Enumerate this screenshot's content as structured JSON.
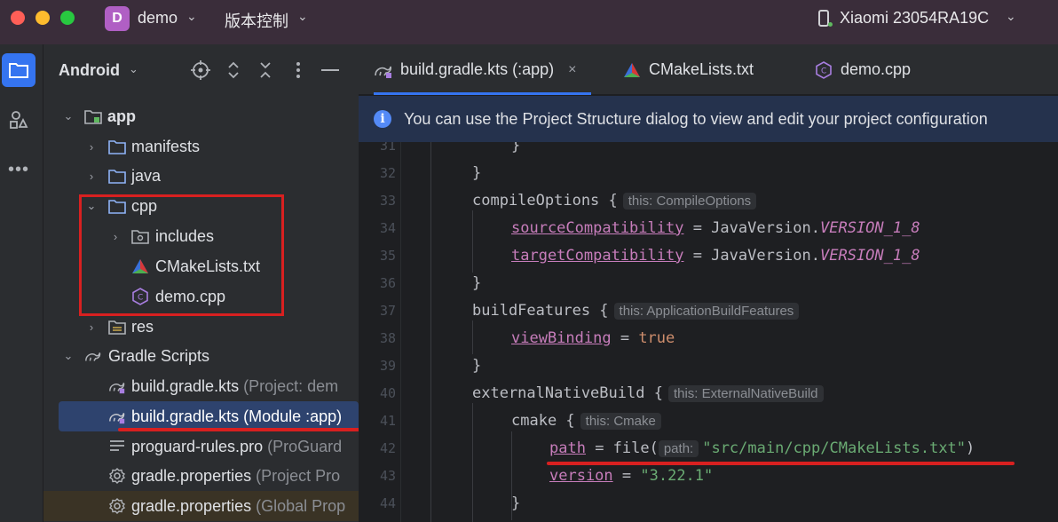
{
  "titlebar": {
    "project_initial": "D",
    "project_name": "demo",
    "vcs_label": "版本控制",
    "device_name": "Xiaomi 23054RA19C"
  },
  "project_panel": {
    "view_title": "Android",
    "tree": [
      {
        "label": "app",
        "icon": "module-folder-icon",
        "expanded": true
      },
      {
        "label": "manifests",
        "icon": "folder-icon",
        "expanded": false
      },
      {
        "label": "java",
        "icon": "folder-icon",
        "expanded": false
      },
      {
        "label": "cpp",
        "icon": "folder-icon",
        "expanded": true
      },
      {
        "label": "includes",
        "icon": "include-folder-icon",
        "expanded": false
      },
      {
        "label": "CMakeLists.txt",
        "icon": "cmake-icon"
      },
      {
        "label": "demo.cpp",
        "icon": "cpp-file-icon"
      },
      {
        "label": "res",
        "icon": "res-folder-icon",
        "expanded": false
      },
      {
        "label": "Gradle Scripts",
        "icon": "gradle-icon",
        "expanded": true
      },
      {
        "label": "build.gradle.kts",
        "hint": "(Project: dem",
        "icon": "gradle-icon"
      },
      {
        "label": "build.gradle.kts",
        "hint": "(Module :app)",
        "icon": "gradle-icon",
        "selected": true
      },
      {
        "label": "proguard-rules.pro",
        "hint": "(ProGuard",
        "icon": "text-file-icon"
      },
      {
        "label": "gradle.properties",
        "hint": "(Project Pro",
        "icon": "settings-icon"
      },
      {
        "label": "gradle.properties",
        "hint": "(Global Prop",
        "icon": "settings-icon"
      }
    ]
  },
  "tabs": [
    {
      "label": "build.gradle.kts (:app)",
      "icon": "gradle-icon",
      "active": true,
      "close": "×"
    },
    {
      "label": "CMakeLists.txt",
      "icon": "cmake-icon"
    },
    {
      "label": "demo.cpp",
      "icon": "cpp-file-icon"
    }
  ],
  "banner": {
    "icon": "i",
    "text": "You can use the Project Structure dialog to view and edit your project configuration"
  },
  "code": {
    "line_numbers": [
      "31",
      "32",
      "33",
      "34",
      "35",
      "36",
      "37",
      "38",
      "39",
      "40",
      "41",
      "42",
      "43",
      "44"
    ],
    "l31": "}",
    "l32": "}",
    "l33_a": "compileOptions {",
    "l33_hint": "this: CompileOptions",
    "l34_prop": "sourceCompatibility",
    "l34_mid": " = JavaVersion.",
    "l34_const": "VERSION_1_8",
    "l35_prop": "targetCompatibility",
    "l35_mid": " = JavaVersion.",
    "l35_const": "VERSION_1_8",
    "l36": "}",
    "l37_a": "buildFeatures {",
    "l37_hint": "this: ApplicationBuildFeatures",
    "l38_prop": "viewBinding",
    "l38_mid": " = ",
    "l38_kw": "true",
    "l39": "}",
    "l40_a": "externalNativeBuild {",
    "l40_hint": "this: ExternalNativeBuild",
    "l41_a": "cmake {",
    "l41_hint": "this: Cmake",
    "l42_prop": "path",
    "l42_mid": " = file(",
    "l42_hint": "path:",
    "l42_str": "\"src/main/cpp/CMakeLists.txt\"",
    "l42_end": ")",
    "l43_prop": "version",
    "l43_mid": " = ",
    "l43_str": "\"3.22.1\"",
    "l44": "}"
  },
  "colors": {
    "accent": "#3574f0",
    "annotation_red": "#d82020",
    "titlebar": "#3a2d3a"
  }
}
